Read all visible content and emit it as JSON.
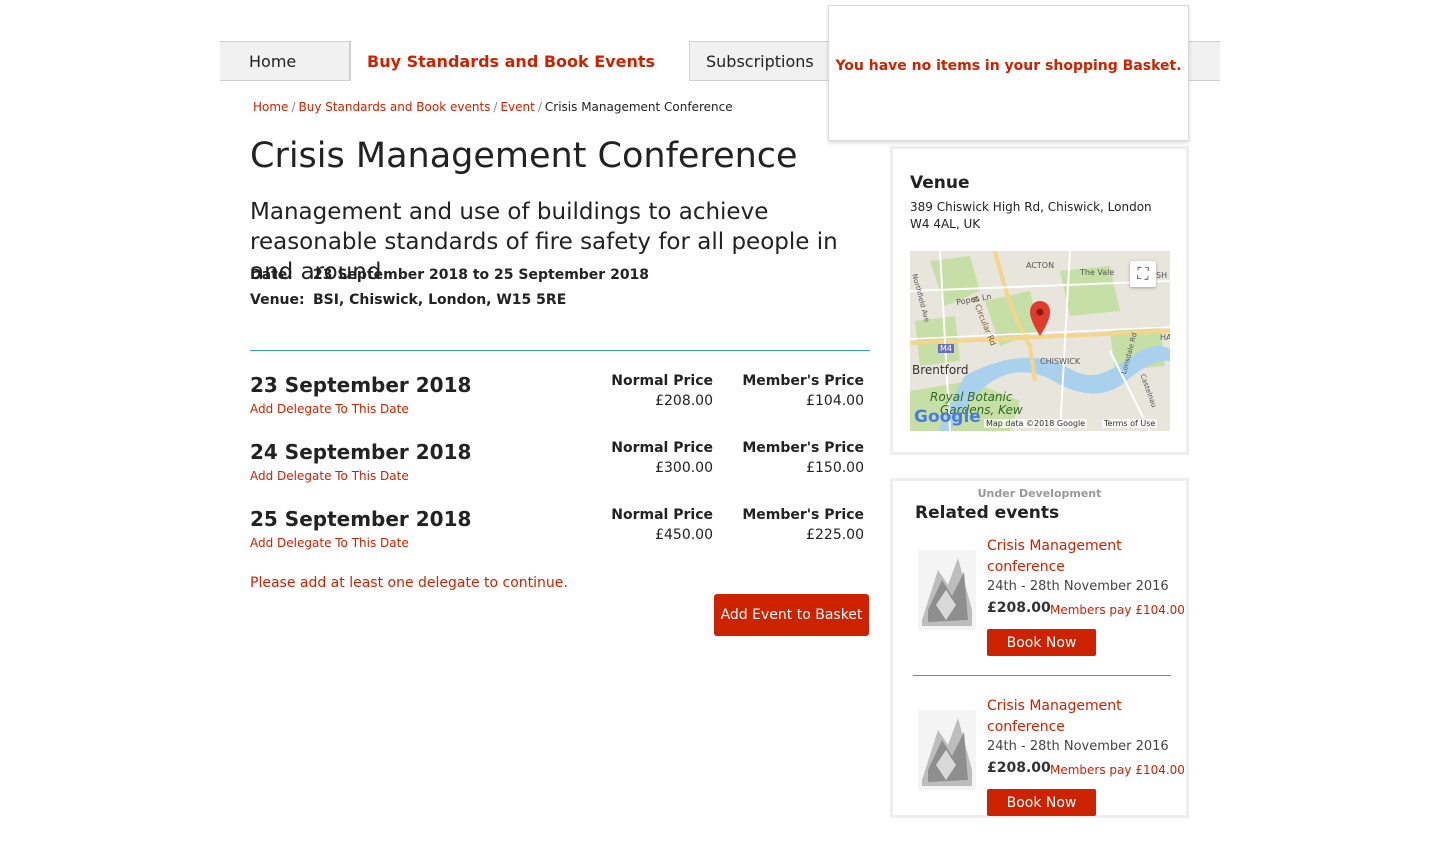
{
  "nav": {
    "items": [
      {
        "label": "Home"
      },
      {
        "label": "Buy Standards and Book Events"
      },
      {
        "label": "Subscriptions"
      }
    ]
  },
  "basket": {
    "message": "You have no items in your shopping Basket."
  },
  "breadcrumb": {
    "items": [
      "Home",
      "Buy Standards and Book events",
      "Event",
      "Crisis Management Conference"
    ]
  },
  "event": {
    "title": "Crisis Management Conference",
    "subtitle": "Management and use of buildings to achieve reasonable standards of fire safety for all people in and around",
    "date_label": "Date:",
    "date_value": "23 September 2018 to 25 September 2018",
    "venue_label": "Venue:",
    "venue_value": "BSI, Chiswick, London, W15 5RE"
  },
  "dates": [
    {
      "title": "23 September 2018",
      "link": "Add Delegate To This Date",
      "normal_label": "Normal Price",
      "normal_price": "£208.00",
      "member_label": "Member's Price",
      "member_price": "£104.00"
    },
    {
      "title": "24 September 2018",
      "link": "Add Delegate To This Date",
      "normal_label": "Normal Price",
      "normal_price": "£300.00",
      "member_label": "Member's Price",
      "member_price": "£150.00"
    },
    {
      "title": "25 September 2018",
      "link": "Add Delegate To This Date",
      "normal_label": "Normal Price",
      "normal_price": "£450.00",
      "member_label": "Member's Price",
      "member_price": "£225.00"
    }
  ],
  "warning": "Please add at least one delegate to continue.",
  "add_to_basket": "Add Event to Basket",
  "venue": {
    "title": "Venue",
    "address": "389 Chiswick High Rd, Chiswick, London W4 4AL, UK",
    "map": {
      "labels": {
        "acton": "ACTON",
        "the_vale": "The Vale",
        "sh": "SH",
        "n_circular": "N Circular Rd",
        "popes": "Popes Ln",
        "northfield": "Northfield Ave",
        "m4": "M4",
        "brentford": "Brentford",
        "chiswick": "CHISWICK",
        "ha": "HA",
        "royal": "Royal Botanic",
        "gardens": "Gardens, Kew",
        "lonsdale": "Lonsdale Rd",
        "castelnau": "Castelnau",
        "google": "Google",
        "map_data": "Map data ©2018 Google",
        "terms": "Terms of Use"
      }
    }
  },
  "related": {
    "under_dev": "Under Development",
    "title": "Related events",
    "items": [
      {
        "name": "Crisis Management conference",
        "date": "24th - 28th November 2016",
        "price": "£208.00",
        "member": "Members pay £104.00",
        "button": "Book Now"
      },
      {
        "name": "Crisis Management conference",
        "date": "24th - 28th November 2016",
        "price": "£208.00",
        "member": "Members pay £104.00",
        "button": "Book Now"
      }
    ]
  },
  "colors": {
    "accent": "#cc2200",
    "divider": "#3aa3a3"
  }
}
